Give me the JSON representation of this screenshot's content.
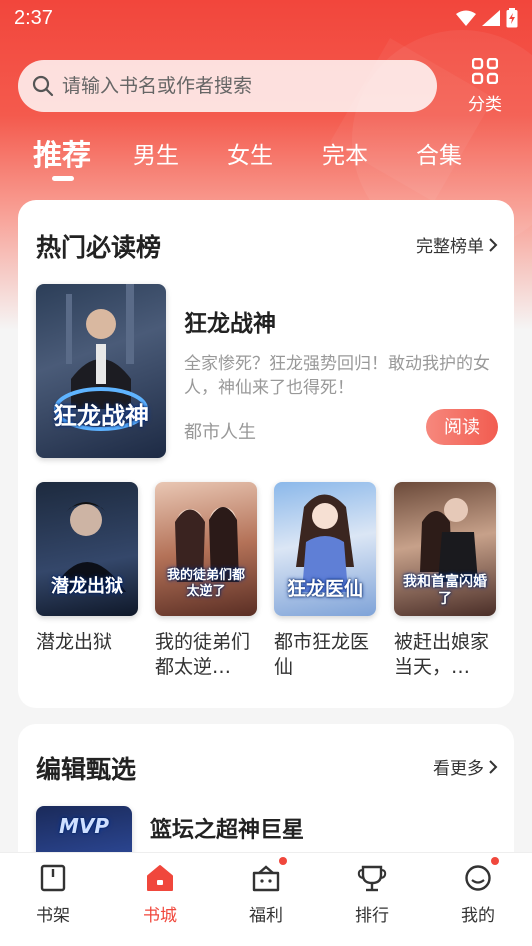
{
  "status_bar": {
    "time": "2:37"
  },
  "search": {
    "placeholder": "请输入书名或作者搜索"
  },
  "category": {
    "label": "分类"
  },
  "tabs": [
    {
      "label": "推荐",
      "active": true
    },
    {
      "label": "男生"
    },
    {
      "label": "女生"
    },
    {
      "label": "完本"
    },
    {
      "label": "合集"
    }
  ],
  "hot_section": {
    "title": "热门必读榜",
    "more_label": "完整榜单",
    "featured": {
      "title": "狂龙战神",
      "cover_text": "狂龙战神",
      "description": "全家惨死？狂龙强势回归！敢动我护的女人，神仙来了也得死！",
      "genre": "都市人生",
      "read_label": "阅读"
    },
    "books": [
      {
        "name": "潜龙出狱",
        "cover_text": "潜龙出狱"
      },
      {
        "name": "我的徒弟们都太逆…",
        "cover_text": "我的徒弟们都太逆了"
      },
      {
        "name": "都市狂龙医仙",
        "cover_text": "狂龙医仙"
      },
      {
        "name": "被赶出娘家当天，…",
        "cover_text": "我和首富闪婚了"
      }
    ]
  },
  "editor_section": {
    "title": "编辑甄选",
    "more_label": "看更多",
    "first_book": {
      "title": "篮坛之超神巨星",
      "cover_text": "MVP"
    }
  },
  "bottom_nav": [
    {
      "label": "书架",
      "icon": "bookshelf-icon"
    },
    {
      "label": "书城",
      "icon": "bookstore-icon",
      "active": true
    },
    {
      "label": "福利",
      "icon": "welfare-icon",
      "badge": true
    },
    {
      "label": "排行",
      "icon": "trophy-icon"
    },
    {
      "label": "我的",
      "icon": "profile-icon",
      "badge": true
    }
  ],
  "colors": {
    "accent": "#f0473c",
    "header_red": "#f2463c"
  }
}
